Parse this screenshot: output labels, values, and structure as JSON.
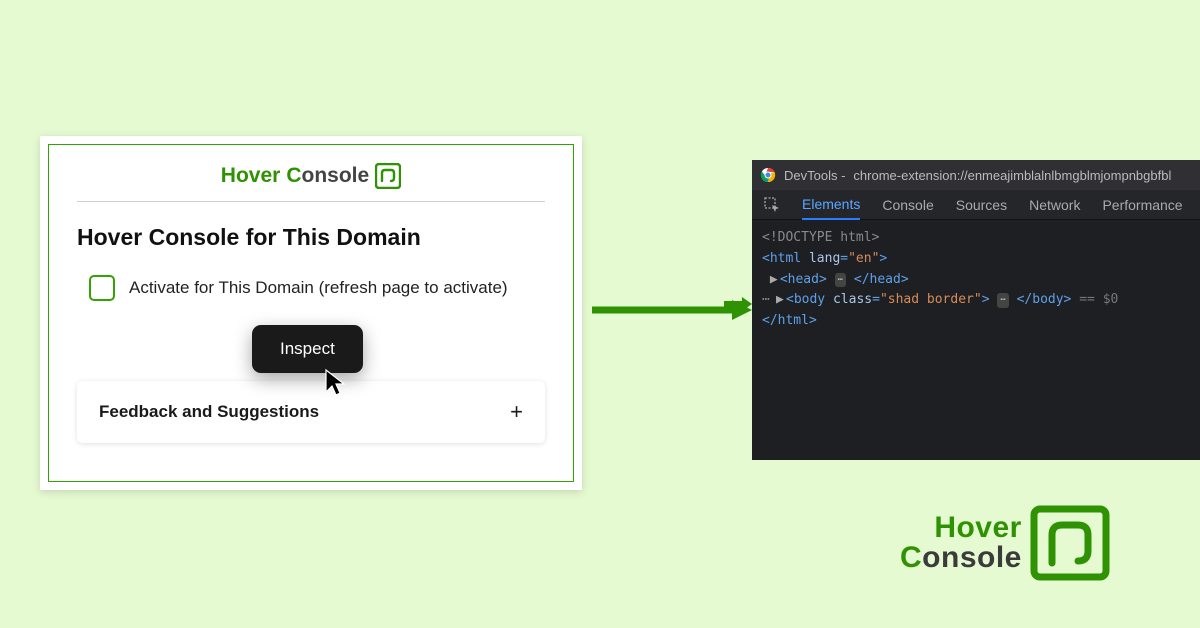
{
  "colors": {
    "green": "#34a203",
    "bg": "#e6fad2",
    "blue": "#2a7dff"
  },
  "popup": {
    "brand_hover": "Hover",
    "brand_console_c": "C",
    "brand_console_rest": "onsole",
    "title": "Hover Console for This Domain",
    "activate_label": "Activate for This Domain (refresh page to activate)",
    "feedback_label": "Feedback and Suggestions",
    "plus": "+"
  },
  "context_menu": {
    "inspect": "Inspect"
  },
  "devtools": {
    "title_prefix": "DevTools - ",
    "title_url": "chrome-extension://enmeajimblalnlbmgblmjompnbgbfbl",
    "tabs": {
      "elements": "Elements",
      "console": "Console",
      "sources": "Sources",
      "network": "Network",
      "performance": "Performance"
    },
    "code": {
      "doctype": "<!DOCTYPE html>",
      "html_open_pre": "<html ",
      "html_lang_attr": "lang",
      "html_lang_eq": "=",
      "html_lang_val": "\"en\"",
      "html_open_post": ">",
      "head_open": "<head>",
      "head_ellipsis": "…",
      "head_close": "</head>",
      "body_open_pre": "<body ",
      "body_class_attr": "class",
      "body_class_eq": "=",
      "body_class_val": "\"shad border\"",
      "body_open_post": ">",
      "body_ellipsis": "…",
      "body_close": "</body>",
      "eq_dollar": " == $0",
      "html_close": "</html>"
    }
  },
  "big_logo": {
    "hover": "Hover",
    "c": "C",
    "rest": "onsole"
  }
}
